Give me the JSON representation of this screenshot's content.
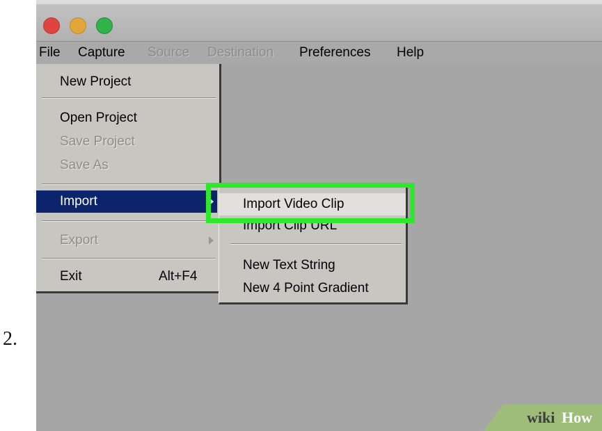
{
  "step_number": "2.",
  "menubar": {
    "items": [
      {
        "label": "File",
        "enabled": true
      },
      {
        "label": "Capture",
        "enabled": true
      },
      {
        "label": "Source",
        "enabled": false
      },
      {
        "label": "Destination",
        "enabled": false
      },
      {
        "label": "Preferences",
        "enabled": true
      },
      {
        "label": "Help",
        "enabled": true
      }
    ]
  },
  "file_menu": {
    "items": [
      {
        "label": "New Project",
        "enabled": true
      },
      {
        "label": "Open Project",
        "enabled": true
      },
      {
        "label": "Save Project",
        "enabled": false
      },
      {
        "label": "Save As",
        "enabled": false
      },
      {
        "label": "Import",
        "enabled": true,
        "highlighted": true,
        "submenu": true
      },
      {
        "label": "Export",
        "enabled": false,
        "submenu": true
      },
      {
        "label": "Exit",
        "shortcut": "Alt+F4",
        "enabled": true
      }
    ]
  },
  "import_submenu": {
    "items": [
      {
        "label": "Import Video Clip",
        "highlighted": true
      },
      {
        "label": "Import Clip URL"
      },
      {
        "label": "New Text String"
      },
      {
        "label": "New 4 Point Gradient"
      }
    ]
  },
  "watermark": {
    "part1": "wiki",
    "part2": "How"
  },
  "colors": {
    "highlight_box": "#2ee82e",
    "menu_selection": "#0b246b",
    "window_background": "#a6a6a6",
    "menu_background": "#c8c6c1"
  }
}
